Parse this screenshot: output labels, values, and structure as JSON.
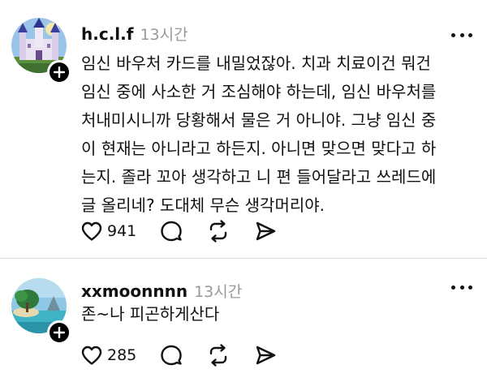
{
  "posts": [
    {
      "username": "h.c.l.f",
      "timestamp": "13시간",
      "lines": [
        "임신 바우처 카드를 내밀었잖아. 치과 치료이건 뭐건",
        "임신 중에 사소한 거 조심해야 하는데, 임신 바우처를",
        "처내미시니까 당황해서 물은 거 아니야. 그냥 임신 중",
        "이 현재는 아니라고 하든지. 아니면 맞으면 맞다고 하",
        "는지. 졸라 꼬아 생각하고 니 편 들어달라고 쓰레드에",
        "글 올리네? 도대체 무슨 생각머리야."
      ],
      "like_count": "941",
      "avatar_icon": "castle-avatar"
    },
    {
      "username": "xxmoonnnn",
      "timestamp": "13시간",
      "lines": [
        "존~나 피곤하게산다"
      ],
      "like_count": "285",
      "avatar_icon": "beach-island-avatar"
    }
  ],
  "icons": {
    "like": "heart-icon",
    "reply": "comment-bubble-icon",
    "repost": "repost-icon",
    "share": "send-icon",
    "more": "more-horizontal-icon",
    "follow": "plus-icon"
  },
  "colors": {
    "text": "#111111",
    "timestamp": "#999999",
    "divider": "#dcdcdc",
    "badge": "#000000"
  }
}
